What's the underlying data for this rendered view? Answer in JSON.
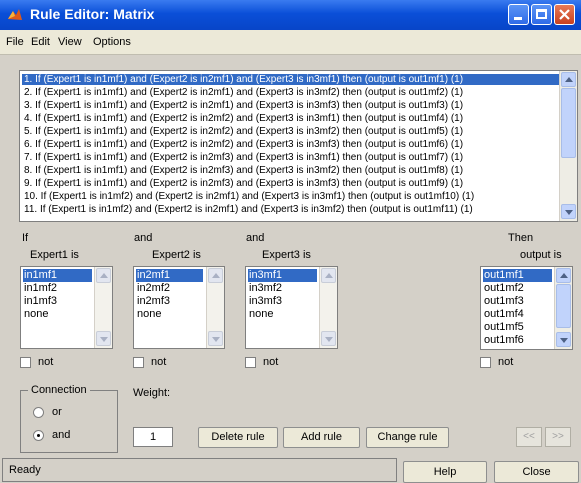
{
  "window": {
    "title": "Rule Editor: Matrix"
  },
  "menu": [
    "File",
    "Edit",
    "View",
    "Options"
  ],
  "rules": [
    "1. If (Expert1 is in1mf1) and (Expert2 is in2mf1) and (Expert3 is in3mf1) then (output is out1mf1) (1)",
    "2. If (Expert1 is in1mf1) and (Expert2 is in2mf1) and (Expert3 is in3mf2) then (output is out1mf2) (1)",
    "3. If (Expert1 is in1mf1) and (Expert2 is in2mf1) and (Expert3 is in3mf3) then (output is out1mf3) (1)",
    "4. If (Expert1 is in1mf1) and (Expert2 is in2mf2) and (Expert3 is in3mf1) then (output is out1mf4) (1)",
    "5. If (Expert1 is in1mf1) and (Expert2 is in2mf2) and (Expert3 is in3mf2) then (output is out1mf5) (1)",
    "6. If (Expert1 is in1mf1) and (Expert2 is in2mf2) and (Expert3 is in3mf3) then (output is out1mf6) (1)",
    "7. If (Expert1 is in1mf1) and (Expert2 is in2mf3) and (Expert3 is in3mf1) then (output is out1mf7) (1)",
    "8. If (Expert1 is in1mf1) and (Expert2 is in2mf3) and (Expert3 is in3mf2) then (output is out1mf8) (1)",
    "9. If (Expert1 is in1mf1) and (Expert2 is in2mf3) and (Expert3 is in3mf3) then (output is out1mf9) (1)",
    "10. If (Expert1 is in1mf2) and (Expert2 is in2mf1) and (Expert3 is in3mf1) then (output is out1mf10) (1)",
    "11. If (Expert1 is in1mf2) and (Expert2 is in2mf1) and (Expert3 is in3mf2) then (output is out1mf11) (1)"
  ],
  "if_label": "If",
  "and_label": "and",
  "then_label": "Then",
  "expert1": {
    "label": "Expert1 is",
    "options": [
      "in1mf1",
      "in1mf2",
      "in1mf3",
      "none"
    ],
    "not": "not"
  },
  "expert2": {
    "label": "Expert2 is",
    "options": [
      "in2mf1",
      "in2mf2",
      "in2mf3",
      "none"
    ],
    "not": "not"
  },
  "expert3": {
    "label": "Expert3 is",
    "options": [
      "in3mf1",
      "in3mf2",
      "in3mf3",
      "none"
    ],
    "not": "not"
  },
  "output": {
    "label": "output is",
    "options": [
      "out1mf1",
      "out1mf2",
      "out1mf3",
      "out1mf4",
      "out1mf5",
      "out1mf6"
    ],
    "not": "not"
  },
  "connection": {
    "label": "Connection",
    "or": "or",
    "and": "and",
    "selected": "and"
  },
  "weight": {
    "label": "Weight:",
    "value": "1"
  },
  "buttons": {
    "delete": "Delete rule",
    "add": "Add rule",
    "change": "Change rule",
    "prev": "<<",
    "next": ">>"
  },
  "status": "Ready",
  "help": "Help",
  "close": "Close"
}
